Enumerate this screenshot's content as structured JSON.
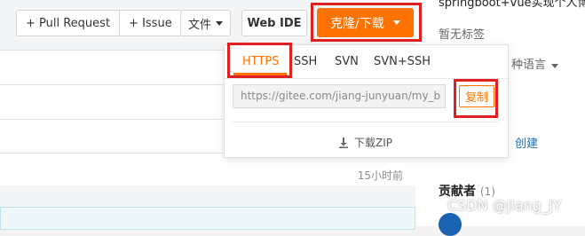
{
  "toolbar": {
    "pull_request": "+ Pull Request",
    "issue": "+ Issue",
    "file": "文件",
    "web_ide": "Web IDE",
    "clone": "克隆/下载"
  },
  "clone_dropdown": {
    "tabs": [
      "HTTPS",
      "SSH",
      "SVN",
      "SVN+SSH"
    ],
    "active_tab": "HTTPS",
    "url_value": "https://gitee.com/jiang-junyuan/my_b",
    "copy_label": "复制",
    "download_zip": "下载ZIP"
  },
  "repo_list": {
    "time": "15小时前"
  },
  "sidebar": {
    "description": "springboot+vue实现个人博",
    "no_tags": "暂无标签",
    "language": "种语言",
    "create": "创建",
    "contributors_label": "贡献者",
    "contributors_count": "(1)"
  },
  "watermark": "CSDN @Jiang_JY",
  "colors": {
    "accent": "#fe7300",
    "highlight": "#e02020",
    "link": "#1f6fb2"
  }
}
